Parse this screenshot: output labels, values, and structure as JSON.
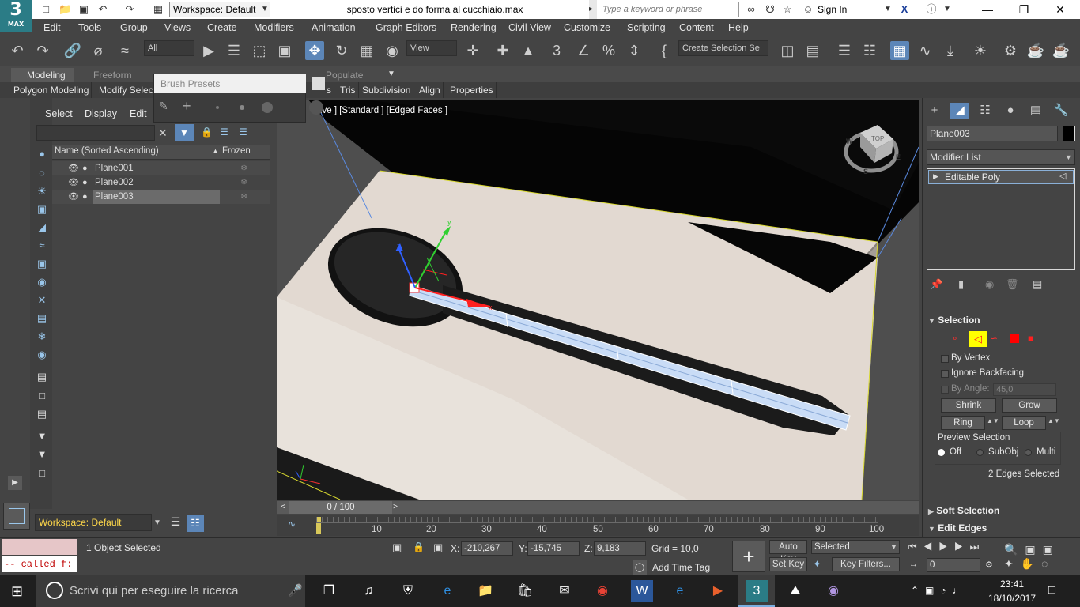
{
  "app": {
    "logo_top": "3",
    "logo_bottom": "MAX",
    "workspace": "Workspace: Default",
    "doc_title": "sposto vertici e do forma al cucchiaio.max",
    "search_placeholder": "Type a keyword or phrase",
    "sign_in": "Sign In"
  },
  "menu": [
    "Edit",
    "Tools",
    "Group",
    "Views",
    "Create",
    "Modifiers",
    "Animation",
    "Graph Editors",
    "Rendering",
    "Civil View",
    "Customize",
    "Scripting",
    "Content",
    "Help"
  ],
  "toolbar": {
    "selection_filter": "All",
    "ref_coord": "View",
    "named_selection": "Create Selection Se"
  },
  "ribbon": {
    "tabs": [
      "Modeling",
      "Freeform",
      "Populate"
    ],
    "sub": [
      "Polygon Modeling",
      "Modify Selec",
      "s",
      "Tris",
      "Subdivision",
      "Align",
      "Properties"
    ]
  },
  "brush_presets": {
    "title": "Brush Presets"
  },
  "scene_explorer": {
    "menus": [
      "Select",
      "Display",
      "Edit"
    ],
    "col_name": "Name (Sorted Ascending)",
    "col_frozen": "Frozen",
    "rows": [
      {
        "name": "Plane001"
      },
      {
        "name": "Plane002"
      },
      {
        "name": "Plane003"
      }
    ],
    "workspace": "Workspace: Default"
  },
  "viewport": {
    "label": "ctive ] [Standard ] [Edged Faces ]",
    "axis_x": "x",
    "axis_y": "y",
    "axis_z": "z",
    "viewcube_label": "TOP",
    "compass": [
      "W",
      "S",
      "E"
    ]
  },
  "time": {
    "slider_text": "0 / 100",
    "ticks": [
      "0",
      "10",
      "20",
      "30",
      "40",
      "50",
      "60",
      "70",
      "80",
      "90",
      "100"
    ]
  },
  "command_panel": {
    "object_name": "Plane003",
    "object_color": "#000000",
    "modifier_list": "Modifier List",
    "stack_item": "Editable Poly",
    "selection_title": "Selection",
    "by_vertex": "By Vertex",
    "ignore_backfacing": "Ignore Backfacing",
    "by_angle": "By Angle:",
    "by_angle_value": "45,0",
    "shrink": "Shrink",
    "grow": "Grow",
    "ring": "Ring",
    "loop": "Loop",
    "preview_selection": "Preview Selection",
    "preview_options": [
      "Off",
      "SubObj",
      "Multi"
    ],
    "selected_info": "2 Edges Selected",
    "soft_selection": "Soft Selection",
    "edit_edges": "Edit Edges"
  },
  "status": {
    "maxscript_output": "-- called f:",
    "objects_selected": "1 Object Selected",
    "x_label": "X:",
    "x_value": "-210,267",
    "y_label": "Y:",
    "y_value": "-15,745",
    "z_label": "Z:",
    "z_value": "9,183",
    "grid": "Grid = 10,0",
    "add_time_tag": "Add Time Tag",
    "auto_key": "Auto Key",
    "set_key": "Set Key",
    "selected": "Selected",
    "key_filters": "Key Filters...",
    "frame": "0"
  },
  "taskbar": {
    "search_placeholder": "Scrivi qui per eseguire la ricerca",
    "time": "23:41",
    "date": "18/10/2017"
  },
  "colors": {
    "ui_bg": "#444444",
    "selection_highlight": "#ffff00",
    "accent_blue": "#9ac6ea",
    "edge_select_red": "#ff0000"
  }
}
